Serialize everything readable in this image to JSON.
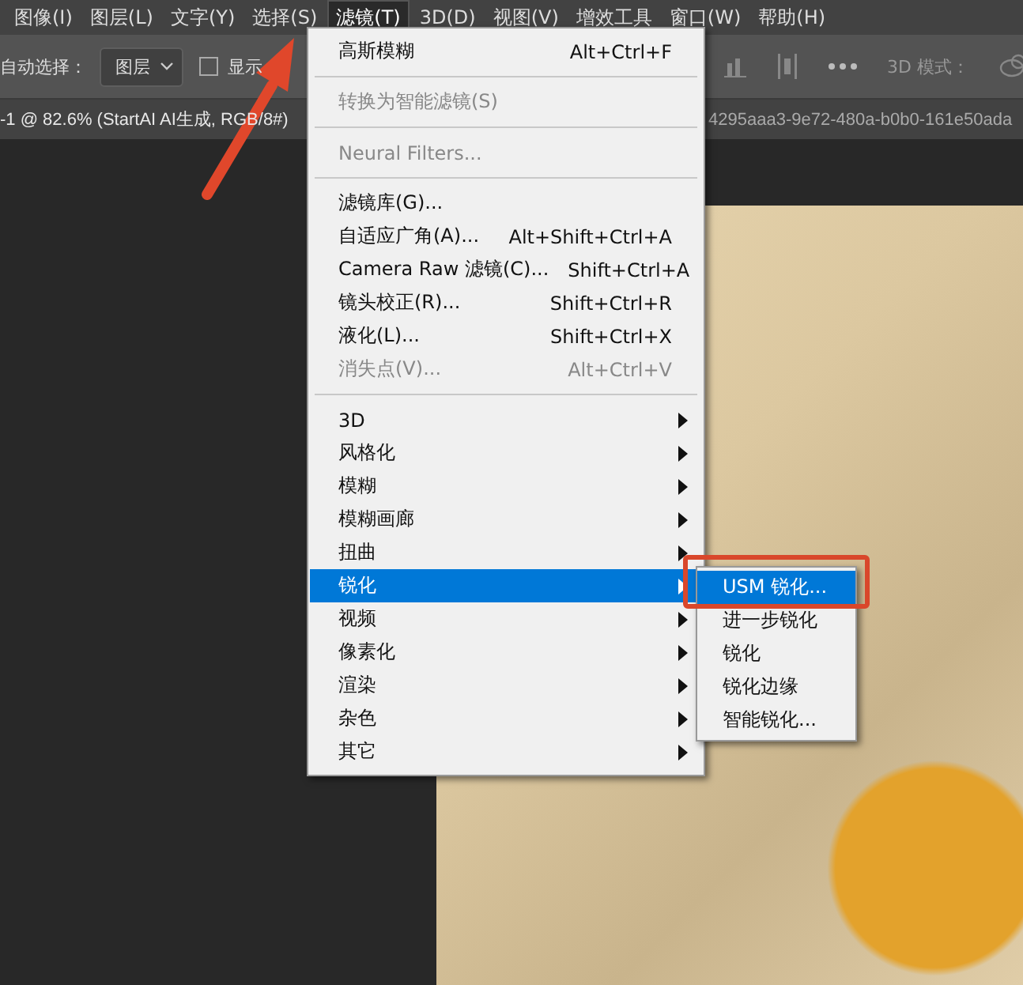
{
  "menubar": [
    {
      "label": "图像(I)",
      "selected": false
    },
    {
      "label": "图层(L)",
      "selected": false
    },
    {
      "label": "文字(Y)",
      "selected": false
    },
    {
      "label": "选择(S)",
      "selected": false
    },
    {
      "label": "滤镜(T)",
      "selected": true
    },
    {
      "label": "3D(D)",
      "selected": false
    },
    {
      "label": "视图(V)",
      "selected": false
    },
    {
      "label": "增效工具",
      "selected": false
    },
    {
      "label": "窗口(W)",
      "selected": false
    },
    {
      "label": "帮助(H)",
      "selected": false
    }
  ],
  "toolbar": {
    "auto_select_label": "自动选择：",
    "layer_dropdown": "图层",
    "show_checkbox": {
      "label": "显示",
      "checked": false
    },
    "mode_label": "3D 模式："
  },
  "doc_tabs": [
    {
      "label": "-1 @ 82.6% (StartAI AI生成, RGB/8#)",
      "selected": true
    },
    {
      "label": "4295aaa3-9e72-480a-b0b0-161e50ada",
      "selected": false
    }
  ],
  "filter_menu": [
    {
      "kind": "item",
      "label": "高斯模糊",
      "shortcut": "Alt+Ctrl+F",
      "disabled": false,
      "submenu": false,
      "selected": false
    },
    {
      "kind": "separator"
    },
    {
      "kind": "item",
      "label": "转换为智能滤镜(S)",
      "disabled": true,
      "submenu": false,
      "selected": false
    },
    {
      "kind": "separator"
    },
    {
      "kind": "item",
      "label": "Neural Filters...",
      "disabled": true,
      "submenu": false,
      "selected": false
    },
    {
      "kind": "separator"
    },
    {
      "kind": "item",
      "label": "滤镜库(G)...",
      "disabled": false,
      "submenu": false,
      "selected": false
    },
    {
      "kind": "item",
      "label": "自适应广角(A)...",
      "shortcut": "Alt+Shift+Ctrl+A",
      "disabled": false,
      "submenu": false,
      "selected": false
    },
    {
      "kind": "item",
      "label": "Camera Raw 滤镜(C)...",
      "shortcut": "Shift+Ctrl+A",
      "disabled": false,
      "submenu": false,
      "selected": false
    },
    {
      "kind": "item",
      "label": "镜头校正(R)...",
      "shortcut": "Shift+Ctrl+R",
      "disabled": false,
      "submenu": false,
      "selected": false
    },
    {
      "kind": "item",
      "label": "液化(L)...",
      "shortcut": "Shift+Ctrl+X",
      "disabled": false,
      "submenu": false,
      "selected": false
    },
    {
      "kind": "item",
      "label": "消失点(V)...",
      "shortcut": "Alt+Ctrl+V",
      "disabled": true,
      "submenu": false,
      "selected": false
    },
    {
      "kind": "separator"
    },
    {
      "kind": "item",
      "label": "3D",
      "disabled": false,
      "submenu": true,
      "selected": false
    },
    {
      "kind": "item",
      "label": "风格化",
      "disabled": false,
      "submenu": true,
      "selected": false
    },
    {
      "kind": "item",
      "label": "模糊",
      "disabled": false,
      "submenu": true,
      "selected": false
    },
    {
      "kind": "item",
      "label": "模糊画廊",
      "disabled": false,
      "submenu": true,
      "selected": false
    },
    {
      "kind": "item",
      "label": "扭曲",
      "disabled": false,
      "submenu": true,
      "selected": false
    },
    {
      "kind": "item",
      "label": "锐化",
      "disabled": false,
      "submenu": true,
      "selected": true
    },
    {
      "kind": "item",
      "label": "视频",
      "disabled": false,
      "submenu": true,
      "selected": false
    },
    {
      "kind": "item",
      "label": "像素化",
      "disabled": false,
      "submenu": true,
      "selected": false
    },
    {
      "kind": "item",
      "label": "渲染",
      "disabled": false,
      "submenu": true,
      "selected": false
    },
    {
      "kind": "item",
      "label": "杂色",
      "disabled": false,
      "submenu": true,
      "selected": false
    },
    {
      "kind": "item",
      "label": "其它",
      "disabled": false,
      "submenu": true,
      "selected": false
    }
  ],
  "sharpen_submenu": [
    {
      "label": "USM 锐化...",
      "selected": true
    },
    {
      "label": "进一步锐化",
      "selected": false
    },
    {
      "label": "锐化",
      "selected": false
    },
    {
      "label": "锐化边缘",
      "selected": false
    },
    {
      "label": "智能锐化...",
      "selected": false
    }
  ]
}
